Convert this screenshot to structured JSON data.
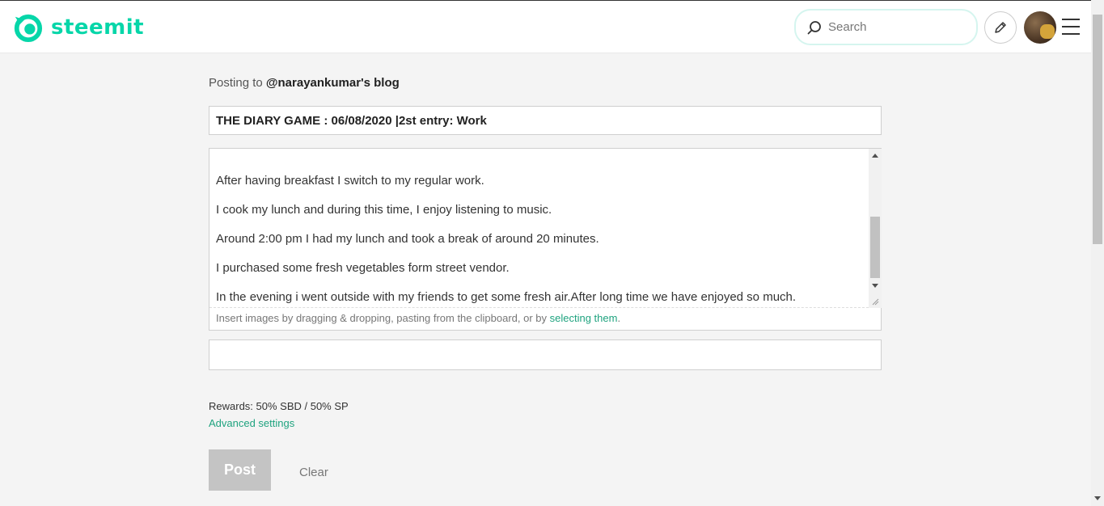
{
  "header": {
    "brand": "steemit",
    "search_placeholder": "Search",
    "accent_color": "#06d6a9"
  },
  "editor": {
    "posting_to_prefix": "Posting to",
    "posting_to_blog": "@narayankumar's blog",
    "title_value": "THE DIARY GAME : 06/08/2020 |2st entry: Work",
    "body_lines": [
      "After having breakfast I switch to my regular work.",
      "I cook my lunch and during this time, I enjoy listening to music.",
      "Around 2:00 pm I had my lunch and took a break of around 20 minutes.",
      "I purchased some fresh vegetables form street vendor.",
      "In the evening i went outside with my friends to get some fresh air.After long time we have enjoyed so much."
    ],
    "hint_text": "Insert images by dragging & dropping, pasting from the clipboard, or by ",
    "hint_link": "selecting them",
    "hint_suffix": ".",
    "tags_value": "",
    "rewards": "Rewards: 50% SBD / 50% SP",
    "advanced_settings": "Advanced settings",
    "post_label": "Post",
    "clear_label": "Clear"
  }
}
